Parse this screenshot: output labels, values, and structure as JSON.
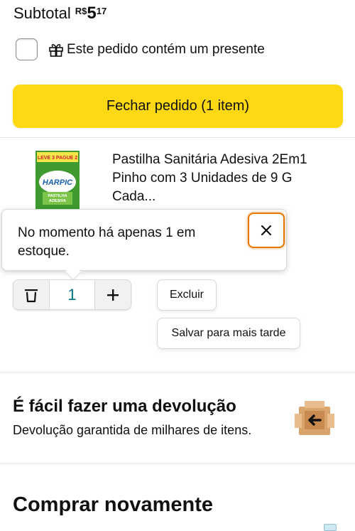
{
  "subtotal": {
    "label": "Subtotal",
    "currency": "R$",
    "whole": "5",
    "cents": "17"
  },
  "gift": {
    "label": "Este pedido contém um presente",
    "checked": false
  },
  "checkout": {
    "label": "Fechar pedido (1 item)",
    "color": "#ffd814"
  },
  "product": {
    "title_line1": "Pastilha Sanitária Adesiva 2Em1",
    "title_line2": "Pinho com 3 Unidades de 9 G",
    "title_line3": "Cada...",
    "box_top": "LEVE 3 PAGUE 2",
    "brand": "HARPIC",
    "box_sub1": "PASTILHA",
    "box_sub2": "ADESIVA"
  },
  "tooltip": {
    "line1": "No momento há apenas 1 em",
    "line2": "estoque."
  },
  "quantity": {
    "value": "1"
  },
  "actions": {
    "delete_label": "Excluir",
    "save_label": "Salvar para mais tarde"
  },
  "returns": {
    "title": "É fácil fazer uma devolução",
    "subtitle": "Devolução garantida de milhares de itens."
  },
  "buy_again": {
    "title": "Comprar novamente"
  },
  "colors": {
    "accent_orange": "#e77600",
    "link_teal": "#007185",
    "text": "#0f1111"
  }
}
